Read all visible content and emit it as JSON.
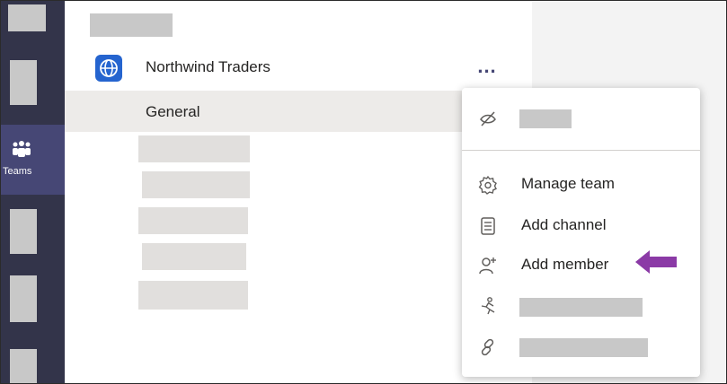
{
  "rail": {
    "teams_label": "Teams"
  },
  "team": {
    "name": "Northwind Traders",
    "more_label": "..."
  },
  "channel": {
    "label": "General"
  },
  "menu": {
    "items": [
      {
        "label": "",
        "icon": "hide-icon"
      },
      {
        "label": "Manage team",
        "icon": "gear-icon"
      },
      {
        "label": "Add channel",
        "icon": "channel-icon"
      },
      {
        "label": "Add member",
        "icon": "add-person-icon"
      },
      {
        "label": "",
        "icon": "leave-icon"
      },
      {
        "label": "",
        "icon": "link-icon"
      }
    ]
  },
  "colors": {
    "rail": "#33344a",
    "rail_selected": "#464775",
    "accent": "#464775",
    "avatar": "#2564cf",
    "arrow": "#8b3aa6"
  }
}
